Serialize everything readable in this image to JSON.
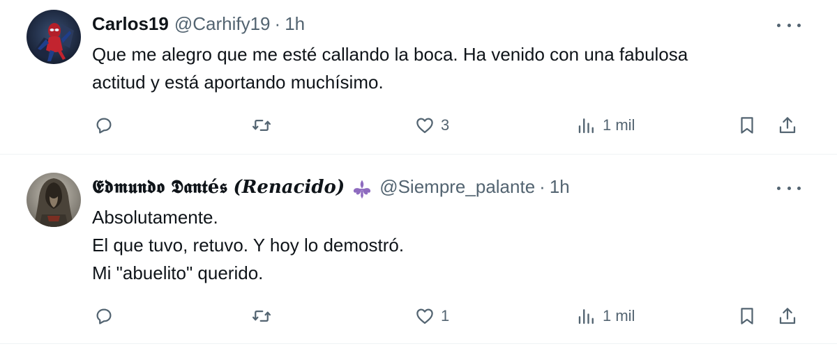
{
  "tweets": [
    {
      "name": "Carlos19",
      "handle": "@Carhify19",
      "separator": "·",
      "time": "1h",
      "lines": [
        "Que me alegro que me esté callando la boca. Ha venido con una fabulosa",
        "actitud y está aportando muchísimo."
      ],
      "likes": "3",
      "views": "1 mil",
      "avatar_icon": "spiderman-avatar"
    },
    {
      "name_fancy": "𝕰𝖉𝖒𝖚𝖓𝖉𝖔 𝕯𝖆𝖓𝖙é𝖘",
      "name_italic": "(𝑹𝒆𝒏𝒂𝒄𝒊𝒅𝒐)",
      "badge_icon": "fleur-de-lis-icon",
      "handle": "@Siempre_palante",
      "separator": "·",
      "time": "1h",
      "lines": [
        "Absolutamente.",
        "El que tuvo, retuvo. Y hoy lo demostró.",
        "Mi \"abuelito\" querido."
      ],
      "likes": "1",
      "views": "1 mil",
      "avatar_icon": "hooded-figure-avatar"
    }
  ],
  "colors": {
    "text": "#0f1419",
    "secondary": "#536471",
    "divider": "#eff3f4",
    "badge": "#8e6bbf"
  }
}
